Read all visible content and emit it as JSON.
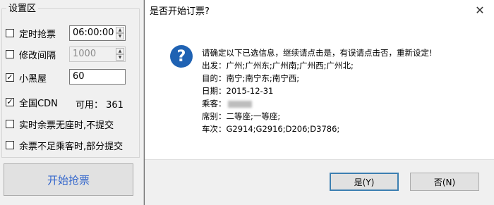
{
  "settings": {
    "group_title": "设置区",
    "timed_grab": {
      "label": "定时抢票",
      "checked": false,
      "value": "06:00:00"
    },
    "modify_interval": {
      "label": "修改间隔",
      "checked": false,
      "value": "1000"
    },
    "blacklist": {
      "label": "小黑屋",
      "checked": true,
      "value": "60"
    },
    "all_cdn": {
      "label": "全国CDN",
      "checked": true,
      "available": "可用： 361"
    },
    "realtime_no_seat": {
      "label": "实时余票无座时,不提交",
      "checked": false
    },
    "partial_submit": {
      "label": "余票不足乘客时,部分提交",
      "checked": false
    },
    "start_button": "开始抢票",
    "check_mark": "✓",
    "spin_up": "▲",
    "spin_down": "▼"
  },
  "dialog": {
    "title": "是否开始订票?",
    "close_glyph": "✕",
    "icon_glyph": "?",
    "message": [
      "请确定以下已选信息，继续请点击是，有误请点击否，重新设定!",
      "出发：广州;广州东;广州南;广州西;广州北;",
      "目的：南宁;南宁东;南宁西;",
      "日期：2015-12-31",
      "乘客：",
      "席别：二等座;一等座;",
      "车次：G2914;G2916;D206;D3786;"
    ],
    "yes_button": "是(Y)",
    "no_button": "否(N)"
  },
  "colors": {
    "accent_blue": "#3366cc",
    "question_icon": "#1f62b3",
    "default_button_border": "#3c7fb1"
  }
}
